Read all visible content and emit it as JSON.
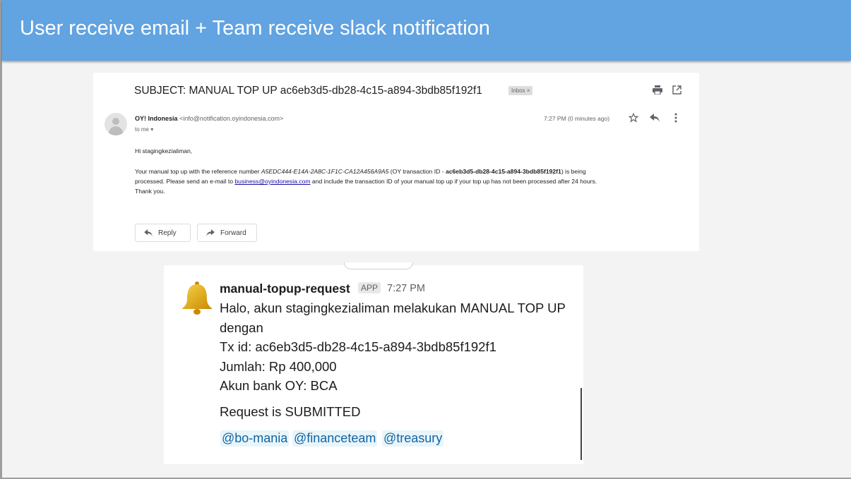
{
  "slide": {
    "title": "User receive email + Team receive slack notification"
  },
  "email": {
    "subject": "SUBJECT: MANUAL TOP UP ac6eb3d5-db28-4c15-a894-3bdb85f192f1",
    "inbox_label": "Inbox",
    "inbox_close": "×",
    "sender_name": "OY! Indonesia",
    "sender_address": "<info@notification.oyindonesia.com>",
    "to_me": "to me",
    "time": "7:27 PM (0 minutes ago)",
    "greeting": "Hi stagingkezialiman,",
    "line1_pre": "Your manual top up with the reference number ",
    "reference_number": "A5EDC444-E14A-2A8C-1F1C-CA12A456A9A5",
    "line1_mid": " (OY transaction ID - ",
    "transaction_id": "ac6eb3d5-db28-4c15-a894-3bdb85f192f1",
    "line1_post": ") is being",
    "line2_pre": "processed. Please send an e-mail to ",
    "support_email": "business@oyindonesia.com",
    "line2_post": " and include the transaction ID of your manual top up if your top up has not been processed after 24 hours.",
    "thanks": "Thank you.",
    "reply_label": "Reply",
    "forward_label": "Forward",
    "icons": [
      "print-icon",
      "open-in-new-icon",
      "star-icon",
      "reply-icon",
      "more-vert-icon"
    ]
  },
  "slack": {
    "bot_name": "manual-topup-request",
    "app_badge": "APP",
    "time": "7:27 PM",
    "line1": "Halo, akun stagingkezialiman melakukan MANUAL TOP UP",
    "line2": "dengan",
    "line3": "Tx id: ac6eb3d5-db28-4c15-a894-3bdb85f192f1",
    "line4": "Jumlah: Rp 400,000",
    "line5": "Akun bank OY: BCA",
    "status": "Request is SUBMITTED",
    "mentions": [
      "@bo-mania",
      "@financeteam",
      "@treasury"
    ]
  },
  "colors": {
    "header_bg": "#62a3e1",
    "mention_text": "#1264a3",
    "mention_bg": "#e8f5fa"
  }
}
